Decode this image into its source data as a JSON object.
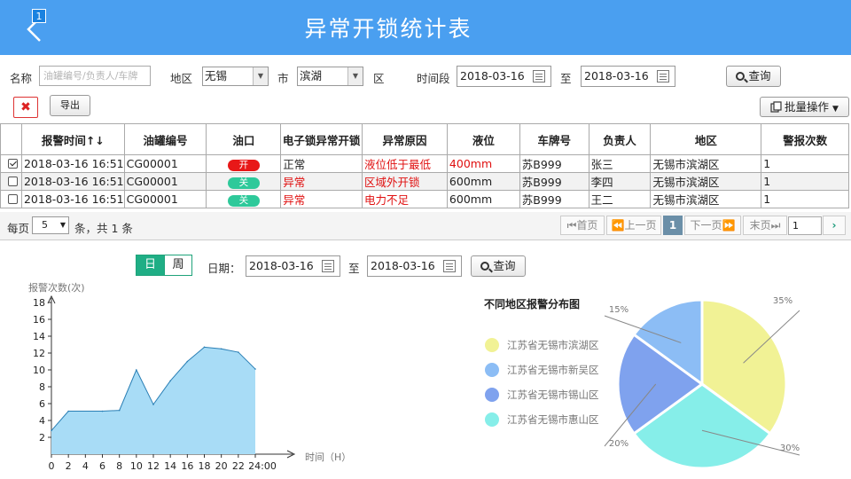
{
  "header": {
    "badge": "1",
    "title": "异常开锁统计表"
  },
  "filters": {
    "name_label": "名称",
    "name_placeholder": "油罐编号/负责人/车牌",
    "region_label": "地区",
    "region_value": "无锡",
    "city_label": "市",
    "city_value": "滨湖",
    "district_label": "区",
    "period_label": "时间段",
    "date_from": "2018-03-16",
    "to_label": "至",
    "date_to": "2018-03-16",
    "search_label": "查询"
  },
  "toolbar": {
    "delete_icon": "✖",
    "export_label": "导出",
    "batch_label": "批量操作"
  },
  "table": {
    "columns": [
      "报警时间↑↓",
      "油罐编号",
      "油口",
      "电子锁异常开锁",
      "异常原因",
      "液位",
      "车牌号",
      "负责人",
      "地区",
      "警报次数"
    ],
    "rows": [
      {
        "checked": true,
        "time": "2018-03-16 16:51",
        "tank": "CG00001",
        "port": "开",
        "port_state": "open",
        "lock": "正常",
        "lock_red": false,
        "reason": "液位低于最低",
        "level": "400mm",
        "level_red": true,
        "plate": "苏B999",
        "owner": "张三",
        "area": "无锡市滨湖区",
        "count": "1"
      },
      {
        "checked": false,
        "time": "2018-03-16 16:51",
        "tank": "CG00001",
        "port": "关",
        "port_state": "closed",
        "lock": "异常",
        "lock_red": true,
        "reason": "区域外开锁",
        "level": "600mm",
        "level_red": false,
        "plate": "苏B999",
        "owner": "李四",
        "area": "无锡市滨湖区",
        "count": "1"
      },
      {
        "checked": false,
        "time": "2018-03-16 16:51",
        "tank": "CG00001",
        "port": "关",
        "port_state": "closed",
        "lock": "异常",
        "lock_red": true,
        "reason": "电力不足",
        "level": "600mm",
        "level_red": false,
        "plate": "苏B999",
        "owner": "王二",
        "area": "无锡市滨湖区",
        "count": "1"
      }
    ]
  },
  "pager": {
    "per_page_label": "每页",
    "per_page_value": "5",
    "summary": "条，共 1 条",
    "first": "首页",
    "prev": "上一页",
    "current": "1",
    "next": "下一页",
    "last": "末页",
    "goto_value": "1"
  },
  "stats": {
    "tab_day": "日",
    "tab_week": "周",
    "date_label": "日期：",
    "date_from": "2018-03-16",
    "to_label": "至",
    "date_to": "2018-03-16",
    "search_label": "查询"
  },
  "chart_data": [
    {
      "type": "area",
      "title": "",
      "ylabel": "报警次数(次)",
      "xlabel": "时间（H）",
      "x": [
        0,
        2,
        6,
        8,
        10,
        12,
        14,
        16,
        18,
        20,
        22,
        24
      ],
      "values": [
        2.8,
        5.1,
        5.1,
        5.2,
        10,
        5.9,
        8.7,
        11,
        12.7,
        12.5,
        12.1,
        10.1
      ],
      "x_ticks": [
        "0",
        "2",
        "4",
        "6",
        "8",
        "10",
        "12",
        "14",
        "16",
        "18",
        "20",
        "22",
        "24:00"
      ],
      "y_ticks": [
        "2",
        "4",
        "6",
        "8",
        "10",
        "12",
        "14",
        "16",
        "18"
      ],
      "ylim": [
        0,
        20
      ],
      "xlim": [
        0,
        24
      ],
      "fill_color": "#a8dcf6",
      "line_color": "#2a7fb5"
    },
    {
      "type": "pie",
      "title": "不同地区报警分布图",
      "legend_position": "left",
      "slices": [
        {
          "label": "江苏省无锡市滨湖区",
          "value": 35,
          "pct_label": "35%",
          "color": "#f1f295"
        },
        {
          "label": "江苏省无锡市惠山区",
          "value": 30,
          "pct_label": "30%",
          "color": "#86eee9"
        },
        {
          "label": "江苏省无锡市锡山区",
          "value": 20,
          "pct_label": "20%",
          "color": "#7fa2ee"
        },
        {
          "label": "江苏省无锡市新吴区",
          "value": 15,
          "pct_label": "15%",
          "color": "#8cbdf5"
        }
      ],
      "legend": [
        {
          "label": "江苏省无锡市滨湖区",
          "color": "#f1f295"
        },
        {
          "label": "江苏省无锡市新吴区",
          "color": "#8cbdf5"
        },
        {
          "label": "江苏省无锡市锡山区",
          "color": "#7fa2ee"
        },
        {
          "label": "江苏省无锡市惠山区",
          "color": "#86eee9"
        }
      ]
    }
  ]
}
